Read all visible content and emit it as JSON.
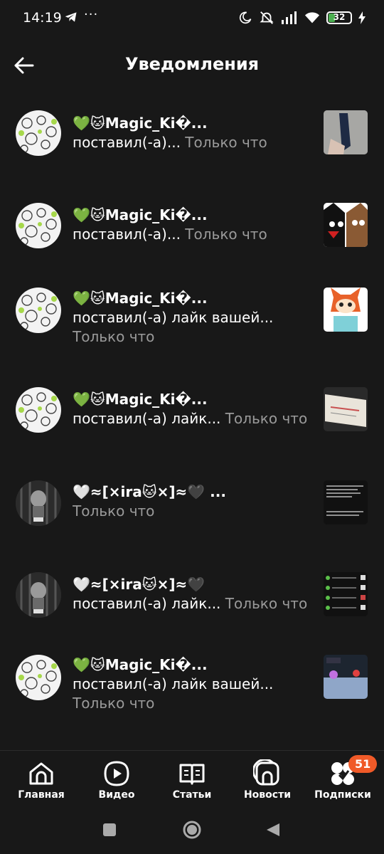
{
  "status_bar": {
    "time": "14:19",
    "dots": "···",
    "battery": "32"
  },
  "header": {
    "title": "Уведомления"
  },
  "notifications": [
    {
      "name": "💚🐱Magic_Ki�...",
      "line1": "поставил(-а)...",
      "time": "Только что",
      "line2": ""
    },
    {
      "name": "💚🐱Magic_Ki�...",
      "line1": "поставил(-а)...",
      "time": "Только что",
      "line2": ""
    },
    {
      "name": "💚🐱Magic_Ki�...",
      "line1": "поставил(-а) лайк вашей...",
      "time": "",
      "line2": "Только что"
    },
    {
      "name": "💚🐱Magic_Ki�...",
      "line1": "поставил(-а) лайк...",
      "time": "Только что",
      "line2": ""
    },
    {
      "name": "🤍≈[×ira🐱×]≈🖤 ...",
      "line1": "Только что",
      "time": "",
      "line2": ""
    },
    {
      "name": "🤍≈[×ira🐱×]≈🖤",
      "line1": "поставил(-а) лайк...",
      "time": "Только что",
      "line2": ""
    },
    {
      "name": "💚🐱Magic_Ki�...",
      "line1": "поставил(-а) лайк вашей...",
      "time": "",
      "line2": "Только что"
    }
  ],
  "bottom_nav": {
    "items": [
      {
        "label": "Главная",
        "icon": "home-icon"
      },
      {
        "label": "Видео",
        "icon": "video-icon"
      },
      {
        "label": "Статьи",
        "icon": "articles-icon"
      },
      {
        "label": "Новости",
        "icon": "news-icon"
      },
      {
        "label": "Подписки",
        "icon": "subscriptions-icon"
      }
    ],
    "badge": "51"
  },
  "colors": {
    "background": "#181818",
    "accent_badge": "#f05a28",
    "secondary_text": "#9a9a9a"
  }
}
